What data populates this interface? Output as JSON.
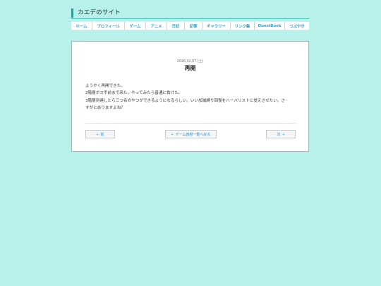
{
  "site": {
    "title": "カエデのサイト"
  },
  "nav": {
    "items": [
      {
        "label": "ホーム"
      },
      {
        "label": "プロフィール"
      },
      {
        "label": "ゲーム"
      },
      {
        "label": "アニメ"
      },
      {
        "label": "日記"
      },
      {
        "label": "記事"
      },
      {
        "label": "ギャラリー"
      },
      {
        "label": "リンク集"
      },
      {
        "label": "GuestBook"
      },
      {
        "label": "つぶやき"
      }
    ]
  },
  "post": {
    "date": "2026.02.07 (土)",
    "title": "再開",
    "lines": [
      "ようやく再開できた。",
      "2階層ボス手前まで来た。やってみたら普通に負けた。",
      "3階層到達したら三つ名のやつができるようになるらしい。いい加減縛り回復をハーバリストに覚えさせたい。さ",
      "すがにありますよね？"
    ]
  },
  "pager": {
    "prev_label": "← 前",
    "list_label": "← ゲーム感想一覧へ戻る",
    "next_label": "次 →"
  },
  "colors": {
    "background": "#b8f0ea",
    "accent": "#17a79b",
    "link": "#1f8ecf"
  }
}
